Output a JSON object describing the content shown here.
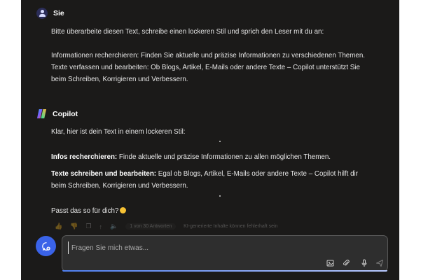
{
  "user_message": {
    "author": "Sie",
    "paragraphs": [
      "Bitte überarbeite diesen Text, schreibe einen lockeren Stil und sprich den Leser mit du an:",
      "Informationen recherchieren: Finden Sie aktuelle und präzise Informationen zu verschiedenen Themen.",
      "Texte verfassen und bearbeiten: Ob Blogs, Artikel, E-Mails oder andere Texte – Copilot unterstützt Sie beim Schreiben, Korrigieren und Verbessern."
    ]
  },
  "copilot_message": {
    "author": "Copilot",
    "intro": "Klar, hier ist dein Text in einem lockeren Stil:",
    "item1_bold": "Infos recherchieren:",
    "item1_text": " Finde aktuelle und präzise Informationen zu allen möglichen Themen.",
    "item2_bold": "Texte schreiben und bearbeiten:",
    "item2_text": " Egal ob Blogs, Artikel, E-Mails oder andere Texte – Copilot hilft dir beim Schreiben, Korrigieren und Verbessern.",
    "closing": "Passt das so für dich?"
  },
  "actions": {
    "pill": "1 von 30 Antworten",
    "note": "KI-generierte Inhalte können fehlerhaft sein"
  },
  "composer": {
    "placeholder": "Fragen Sie mich etwas..."
  },
  "colors": {
    "background": "#1b1a19",
    "accent": "#3a63e8"
  }
}
